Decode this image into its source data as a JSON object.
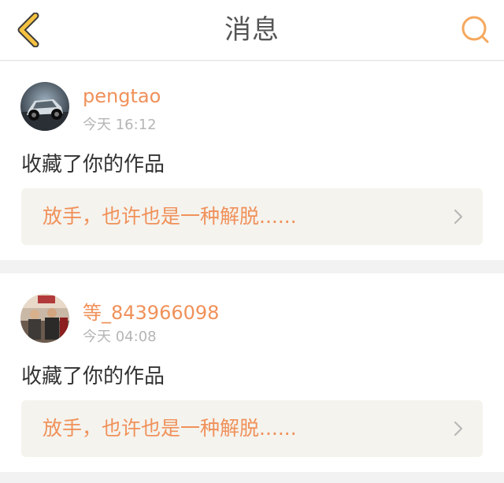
{
  "header": {
    "title": "消息",
    "back_icon": "chevron-left-icon",
    "search_icon": "search-icon",
    "accent_color": "#f5a623"
  },
  "messages": [
    {
      "username": "pengtao",
      "time": "今天 16:12",
      "action": "收藏了你的作品",
      "work_title": "放手，也许也是一种解脱......",
      "avatar": "car-avatar"
    },
    {
      "username": "等_843966098",
      "time": "今天 04:08",
      "action": "收藏了你的作品",
      "work_title": "放手，也许也是一种解脱......",
      "avatar": "people-avatar"
    }
  ],
  "colors": {
    "username": "#f0915a",
    "work_title": "#f0915a",
    "time": "#b5b5b5",
    "work_box_bg": "#f4f3ee",
    "page_bg": "#f2f2f2"
  }
}
